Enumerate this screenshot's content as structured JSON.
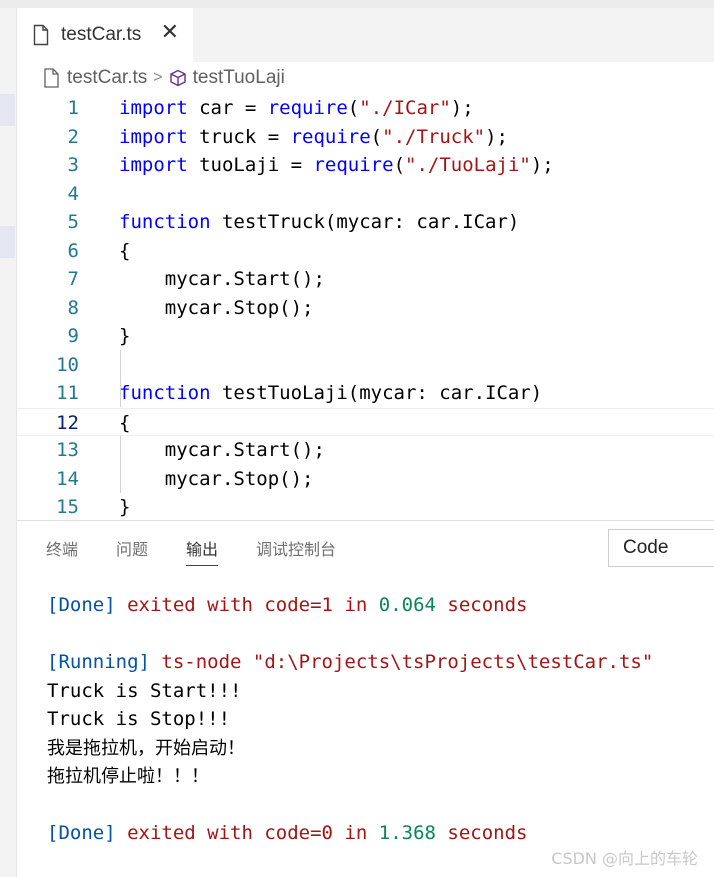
{
  "tab": {
    "title": "testCar.ts",
    "close_glyph": "✕",
    "icon": "file-icon"
  },
  "breadcrumb": {
    "file": "testCar.ts",
    "separator": ">",
    "symbol": "testTuoLaji",
    "symbol_icon": "module-cube-icon"
  },
  "editor": {
    "current_line": 12,
    "colors": {
      "keyword": "#0000ff",
      "string": "#a31515",
      "line_number": "#237893"
    },
    "lines": [
      {
        "n": "1",
        "tokens": [
          {
            "t": "import",
            "c": "kw"
          },
          {
            "t": " car = "
          },
          {
            "t": "require",
            "c": "kw"
          },
          {
            "t": "("
          },
          {
            "t": "\"./ICar\"",
            "c": "str"
          },
          {
            "t": ");"
          }
        ]
      },
      {
        "n": "2",
        "tokens": [
          {
            "t": "import",
            "c": "kw"
          },
          {
            "t": " truck = "
          },
          {
            "t": "require",
            "c": "kw"
          },
          {
            "t": "("
          },
          {
            "t": "\"./Truck\"",
            "c": "str"
          },
          {
            "t": ");"
          }
        ]
      },
      {
        "n": "3",
        "tokens": [
          {
            "t": "import",
            "c": "kw"
          },
          {
            "t": " tuoLaji = "
          },
          {
            "t": "require",
            "c": "kw"
          },
          {
            "t": "("
          },
          {
            "t": "\"./TuoLaji\"",
            "c": "str"
          },
          {
            "t": ");"
          }
        ]
      },
      {
        "n": "4",
        "tokens": []
      },
      {
        "n": "5",
        "tokens": [
          {
            "t": "function",
            "c": "kw"
          },
          {
            "t": " testTruck(mycar: car.ICar)"
          }
        ]
      },
      {
        "n": "6",
        "tokens": [
          {
            "t": "{"
          }
        ]
      },
      {
        "n": "7",
        "tokens": [
          {
            "t": "    mycar.Start();"
          }
        ]
      },
      {
        "n": "8",
        "tokens": [
          {
            "t": "    mycar.Stop();"
          }
        ]
      },
      {
        "n": "9",
        "tokens": [
          {
            "t": "}"
          }
        ]
      },
      {
        "n": "10",
        "tokens": []
      },
      {
        "n": "11",
        "tokens": [
          {
            "t": "function",
            "c": "kw"
          },
          {
            "t": " testTuoLaji(mycar: car.ICar)"
          }
        ]
      },
      {
        "n": "12",
        "tokens": [
          {
            "t": "{"
          }
        ]
      },
      {
        "n": "13",
        "tokens": [
          {
            "t": "    mycar.Start();"
          }
        ]
      },
      {
        "n": "14",
        "tokens": [
          {
            "t": "    mycar.Stop();"
          }
        ]
      },
      {
        "n": "15",
        "tokens": [
          {
            "t": "}"
          }
        ]
      }
    ]
  },
  "panel": {
    "tabs": [
      {
        "label": "终端",
        "active": false
      },
      {
        "label": "问题",
        "active": false
      },
      {
        "label": "输出",
        "active": true
      },
      {
        "label": "调试控制台",
        "active": false
      }
    ],
    "dropdown_value": "Code",
    "output_lines": [
      {
        "tokens": [
          {
            "t": "[Done]",
            "c": "blue"
          },
          {
            "t": " exited with ",
            "c": "red"
          },
          {
            "t": "code=1",
            "c": "red"
          },
          {
            "t": " in ",
            "c": "red"
          },
          {
            "t": "0.064",
            "c": "green"
          },
          {
            "t": " seconds",
            "c": "red"
          }
        ]
      },
      {
        "tokens": []
      },
      {
        "tokens": [
          {
            "t": "[Running]",
            "c": "blue"
          },
          {
            "t": " ts-node ",
            "c": "red"
          },
          {
            "t": "\"d:\\Projects\\tsProjects\\testCar.ts\"",
            "c": "red"
          }
        ]
      },
      {
        "tokens": [
          {
            "t": "Truck is Start!!!"
          }
        ]
      },
      {
        "tokens": [
          {
            "t": "Truck is Stop!!!"
          }
        ]
      },
      {
        "tokens": [
          {
            "t": "我是拖拉机，开始启动！",
            "c": "cjk"
          }
        ]
      },
      {
        "tokens": [
          {
            "t": "拖拉机停止啦！！！",
            "c": "cjk"
          }
        ]
      },
      {
        "tokens": []
      },
      {
        "tokens": [
          {
            "t": "[Done]",
            "c": "blue"
          },
          {
            "t": " exited with ",
            "c": "red"
          },
          {
            "t": "code=0",
            "c": "red"
          },
          {
            "t": " in ",
            "c": "red"
          },
          {
            "t": "1.368",
            "c": "green"
          },
          {
            "t": " seconds",
            "c": "red"
          }
        ]
      }
    ]
  },
  "watermark": "CSDN @向上的车轮"
}
